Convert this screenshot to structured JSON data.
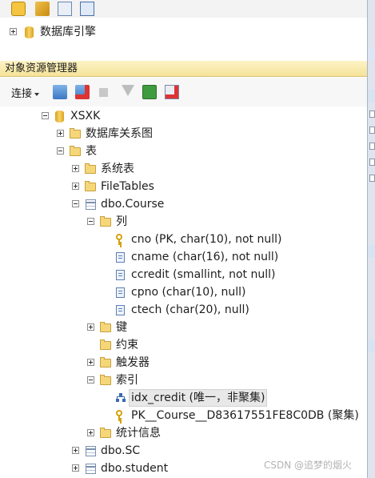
{
  "registered_servers": {
    "item_label": "数据库引擎"
  },
  "object_explorer": {
    "title": "对象资源管理器",
    "connect_label": "连接"
  },
  "tree": {
    "database": "XSXK",
    "db_diagrams": "数据库关系图",
    "tables": "表",
    "system_tables": "系统表",
    "file_tables": "FileTables",
    "course_table": "dbo.Course",
    "columns_folder": "列",
    "columns": [
      "cno (PK, char(10), not null)",
      "cname (char(16), not null)",
      "ccredit (smallint, not null)",
      "cpno (char(10), null)",
      "ctech (char(20), null)"
    ],
    "keys_folder": "键",
    "constraints_folder": "约束",
    "triggers_folder": "触发器",
    "indexes_folder": "索引",
    "indexes": [
      "idx_credit (唯一，非聚集)",
      "PK__Course__D83617551FE8C0DB (聚集)"
    ],
    "statistics_folder": "统计信息",
    "sc_table": "dbo.SC",
    "student_table": "dbo.student"
  },
  "watermark": "CSDN @追梦的烟火",
  "colors": {
    "header_bg": "#f5e39a",
    "selection_bg": "#e8e8e8"
  }
}
